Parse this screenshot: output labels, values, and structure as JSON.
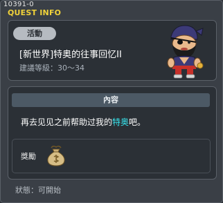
{
  "quest_id": "10391-0",
  "window_title": "QUEST INFO",
  "badge": "活動",
  "quest_title": "[新世界]特奥的往事回忆II",
  "level_requirement": "建議等級：30～34",
  "content": {
    "header": "內容",
    "text_before": "再去见见之前帮助过我的",
    "text_highlight": "特奥",
    "text_after": "吧。"
  },
  "reward": {
    "label": "獎勵",
    "icon": "money-bag-icon"
  },
  "status": "狀態：可開始",
  "colors": {
    "title_accent": "#f0d23a",
    "highlight": "#38e6ef",
    "badge_bg": "#b6bbc1",
    "header_bg": "#4c5965"
  },
  "npc": "pirate-npc"
}
